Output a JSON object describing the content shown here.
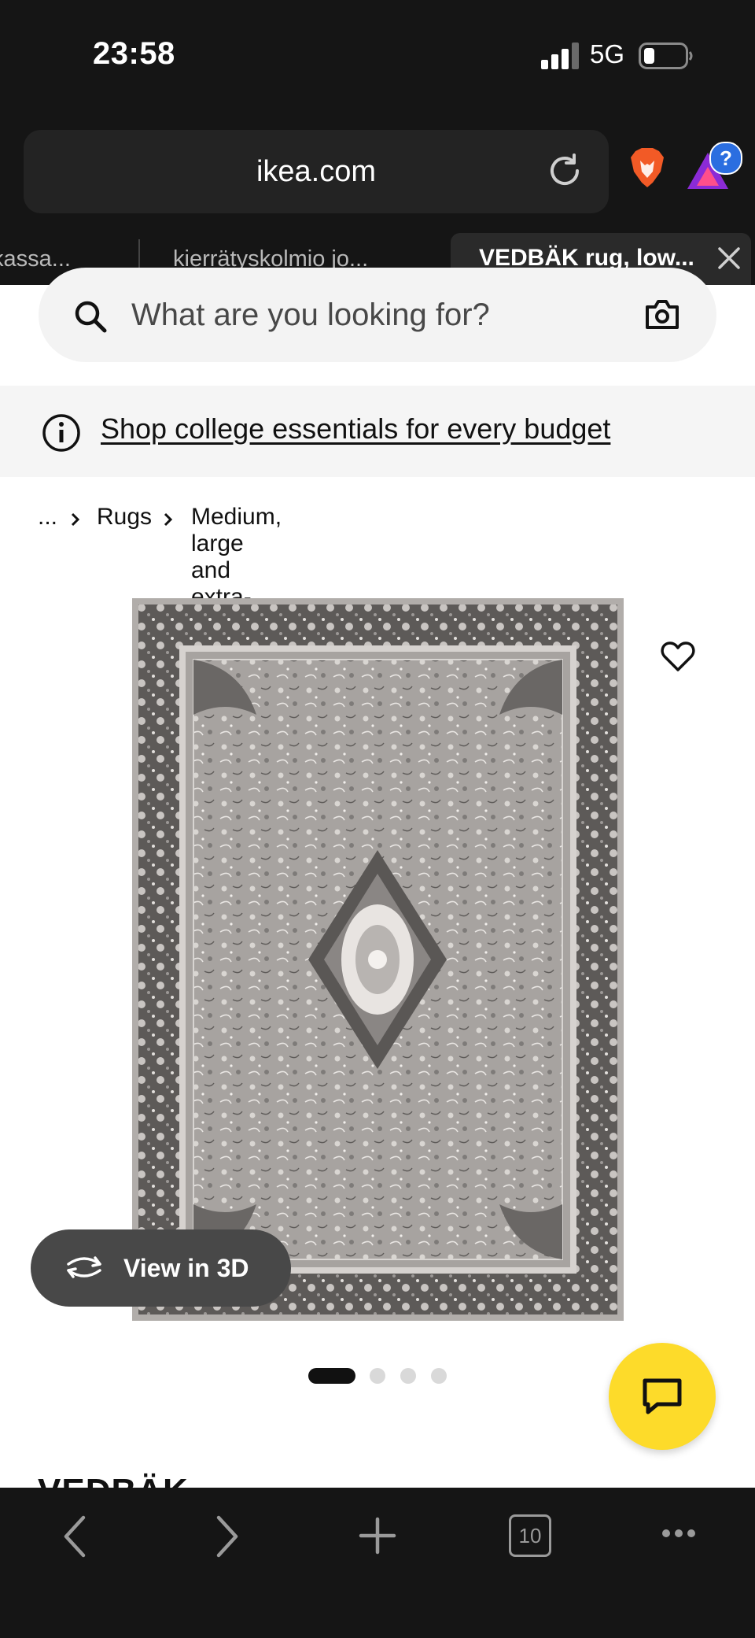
{
  "status_bar": {
    "time": "23:58",
    "network": "5G"
  },
  "browser": {
    "url": "ikea.com",
    "extension_badge": "?",
    "tabs": [
      {
        "label": "kassa..."
      },
      {
        "label": "kierrätyskolmio jo..."
      },
      {
        "label": "VEDBÄK rug, low..."
      }
    ],
    "tab_count": "10"
  },
  "page": {
    "search": {
      "placeholder": "What are you looking for?"
    },
    "banner": {
      "link_text": "Shop college essentials for every budget"
    },
    "breadcrumb": [
      "...",
      "Rugs",
      "Medium, large and extra-large rugs"
    ],
    "view_3d_label": "View in 3D",
    "carousel": {
      "total": 4,
      "active": 1
    },
    "product_title_peek": "VEDBÄK"
  },
  "colors": {
    "accent_yellow": "#fddb2a",
    "chrome_bg": "#151515"
  },
  "icons": [
    "search-icon",
    "camera-icon",
    "info-icon",
    "heart-icon",
    "rotate-3d-icon",
    "chat-icon",
    "back-icon",
    "forward-icon",
    "new-tab-icon",
    "tabs-icon",
    "more-icon",
    "reload-icon",
    "brave-lion-icon",
    "close-icon"
  ]
}
